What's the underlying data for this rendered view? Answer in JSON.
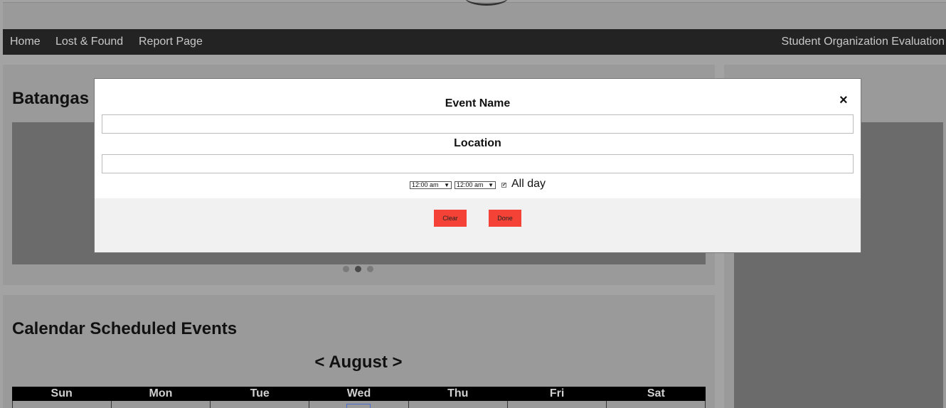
{
  "nav": {
    "home": "Home",
    "lost_found": "Lost & Found",
    "report": "Report Page",
    "evaluation": "Student Organization Evaluation"
  },
  "main": {
    "slider_title": "Batangas",
    "calendar_title": "Calendar Scheduled Events",
    "month_label": "< August >",
    "weekdays": [
      "Sun",
      "Mon",
      "Tue",
      "Wed",
      "Thu",
      "Fri",
      "Sat"
    ],
    "slider_dots": 3,
    "active_dot": 2
  },
  "modal": {
    "event_name_label": "Event Name",
    "event_name_value": "",
    "location_label": "Location",
    "location_value": "",
    "start_time": "12:00 am",
    "end_time": "12:00 am",
    "all_day_checked": true,
    "all_day_label": "All day",
    "clear_label": "Clear",
    "done_label": "Done",
    "close_symbol": "×"
  },
  "colors": {
    "navbar": "#232323",
    "button_red": "#f44336",
    "overlay_gray": "#a3a3a3"
  }
}
